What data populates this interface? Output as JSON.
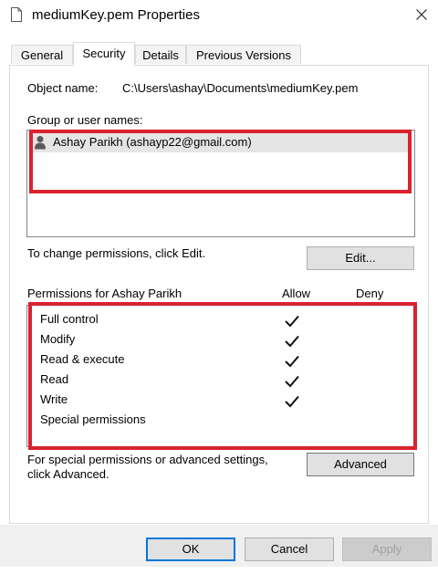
{
  "window": {
    "title": "mediumKey.pem Properties"
  },
  "tabs": [
    {
      "label": "General"
    },
    {
      "label": "Security"
    },
    {
      "label": "Details"
    },
    {
      "label": "Previous Versions"
    }
  ],
  "object": {
    "label": "Object name:",
    "value": "C:\\Users\\ashay\\Documents\\mediumKey.pem"
  },
  "group": {
    "label": "Group or user names:",
    "users": [
      {
        "name": "Ashay Parikh (ashayp22@gmail.com)"
      }
    ]
  },
  "change": {
    "text": "To change permissions, click Edit.",
    "edit_label": "Edit..."
  },
  "permissions": {
    "header": "Permissions for Ashay Parikh",
    "allow_header": "Allow",
    "deny_header": "Deny",
    "rows": [
      {
        "name": "Full control",
        "allow": true,
        "deny": false
      },
      {
        "name": "Modify",
        "allow": true,
        "deny": false
      },
      {
        "name": "Read & execute",
        "allow": true,
        "deny": false
      },
      {
        "name": "Read",
        "allow": true,
        "deny": false
      },
      {
        "name": "Write",
        "allow": true,
        "deny": false
      },
      {
        "name": "Special permissions",
        "allow": false,
        "deny": false
      }
    ]
  },
  "advanced": {
    "text_line1": "For special permissions or advanced settings,",
    "text_line2": "click Advanced.",
    "button_label": "Advanced"
  },
  "footer": {
    "ok_label": "OK",
    "cancel_label": "Cancel",
    "apply_label": "Apply"
  },
  "colors": {
    "highlight_red": "#d9232e",
    "focus_blue": "#0078d7"
  },
  "icons": {
    "file": "file-icon",
    "close": "close-icon",
    "user": "user-icon",
    "check": "checkmark-icon"
  }
}
